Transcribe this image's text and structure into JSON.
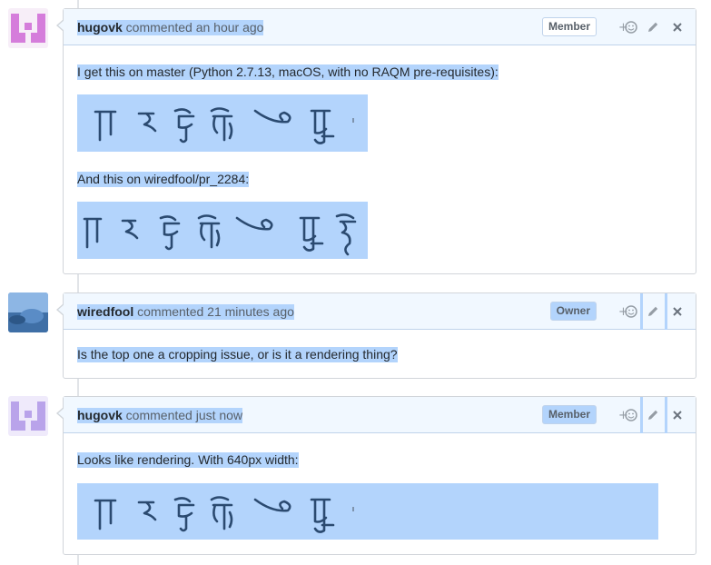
{
  "comments": [
    {
      "author": "hugovk",
      "action": "commented",
      "time": "an hour ago",
      "role": "Member",
      "avatar_color": "#d57ddb",
      "paragraphs": [
        "I get this on master (Python 2.7.13, macOS, with no RAQM pre-requisites):",
        "And this on wiredfool/pr_2284:"
      ]
    },
    {
      "author": "wiredfool",
      "action": "commented",
      "time": "21 minutes ago",
      "role": "Owner",
      "avatar_color": "#4a7fc0",
      "paragraphs": [
        "Is the top one a cropping issue, or is it a rendering thing?"
      ]
    },
    {
      "author": "hugovk",
      "action": "commented",
      "time": "just now",
      "role": "Member",
      "avatar_color": "#b9a3ea",
      "paragraphs": [
        "Looks like rendering. With 640px width:"
      ]
    }
  ],
  "icons": {
    "reaction": "add-reaction-icon",
    "edit": "pencil-icon",
    "delete": "close-icon"
  },
  "colors": {
    "selection": "#b3d4fc",
    "header_bg": "#f1f8ff",
    "border": "#d1d5da",
    "glyph": "#2b4a70"
  }
}
